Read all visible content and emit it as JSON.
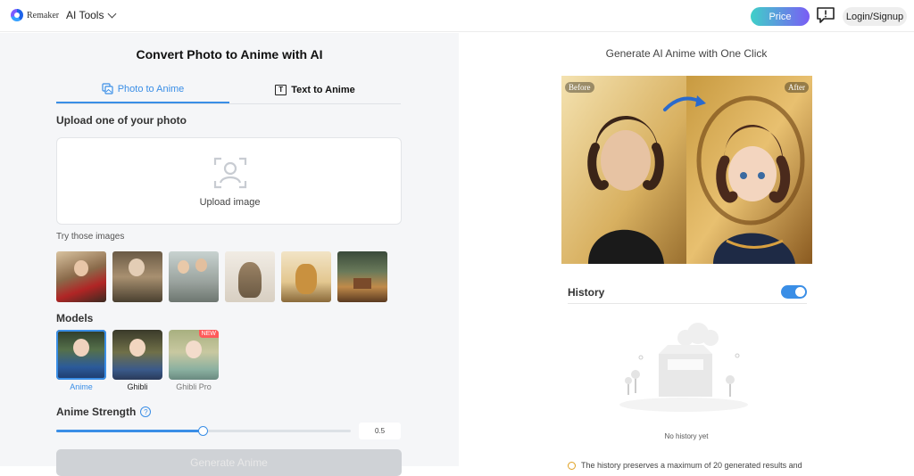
{
  "header": {
    "logo_text": "Remaker",
    "menu_label": "AI Tools",
    "price_label": "Price",
    "login_label": "Login/Signup"
  },
  "left": {
    "title": "Convert Photo to Anime with AI",
    "tabs": [
      {
        "label": "Photo to Anime",
        "active": true
      },
      {
        "label": "Text to Anime",
        "active": false
      }
    ],
    "text_tab_icon_letter": "T",
    "upload_heading": "Upload one of your photo",
    "upload_label": "Upload image",
    "try_label": "Try those images",
    "sample_images": [
      "woman-in-red-scarf",
      "old-man-reading",
      "smiling-couple",
      "tabby-cat",
      "golden-retriever",
      "forest-cabin"
    ],
    "models_heading": "Models",
    "models": [
      {
        "name": "Anime",
        "selected": true,
        "badge": ""
      },
      {
        "name": "Ghibli",
        "selected": false,
        "badge": ""
      },
      {
        "name": "Ghibli Pro",
        "selected": false,
        "badge": "NEW"
      }
    ],
    "strength_label": "Anime Strength",
    "strength_help": "?",
    "strength_value": "0.5",
    "strength_fraction": 0.5,
    "generate_label": "Generate Anime"
  },
  "right": {
    "title": "Generate AI Anime with One Click",
    "before_label": "Before",
    "after_label": "After",
    "history_label": "History",
    "history_toggle_on": true,
    "empty_text": "No history yet",
    "notice_text": "The history preserves a maximum of 20 generated results and"
  },
  "colors": {
    "accent": "#3a8ee6",
    "price_gradient_start": "#3fd0c8",
    "price_gradient_end": "#7a5cf5",
    "new_badge": "#ff5a5a"
  }
}
